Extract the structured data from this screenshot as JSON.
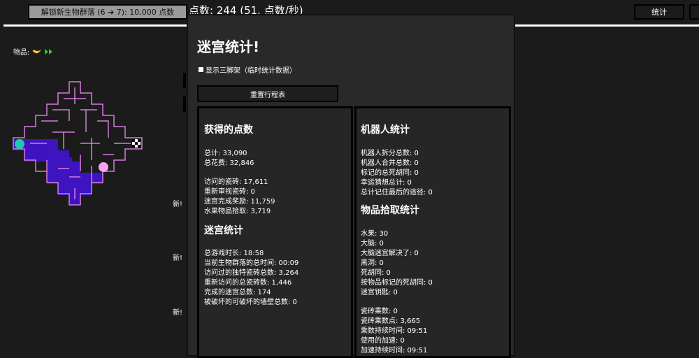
{
  "topbar": {
    "unlock_label": "解锁新生物群落 (6 ➔ 7): 10,000 点数",
    "points_text": "点数: 244 (51. 点数/秒)",
    "stats_label": "统计"
  },
  "items_label": "物品:",
  "new_labels": [
    "新!",
    "新!",
    "新!"
  ],
  "modal": {
    "title": "迷宫统计!",
    "tripod_label": "显示三脚架（临时统计数据）",
    "reset_label": "重置行程表",
    "left": {
      "points_heading": "获得的点数",
      "points_rows": [
        "总计:   33,090",
        "总花费:   32,846",
        "访问的瓷砖:   17,611",
        "重新审视瓷砖:   0",
        "迷宫完成奖励:   11,759",
        "水果物品拾取:   3,719"
      ],
      "maze_heading": "迷宫统计",
      "maze_rows": [
        "总游戏时长:   18:58",
        "当前生物群落的总时间:   00:09",
        "访问过的独特瓷砖总数:   3,264",
        "重新访问的总瓷砖数:   1,446",
        "完成的迷宫总数:   174",
        "被破坏的可破坏的墙壁总数:   0"
      ]
    },
    "right": {
      "robot_heading": "机器人统计",
      "robot_rows": [
        "机器人拆分总数:   0",
        "机器人合并总数:   0",
        "标记的总死胡同:   0",
        "幸运猜想总计:   0",
        "总计记住最后的途径:   0"
      ],
      "item_heading": "物品拾取统计",
      "item_rows": [
        "水果:   30",
        "大脑:   0",
        "大脑迷宫解决了:   0",
        "黑洞:   0",
        "死胡同:   0",
        "按物品标记的死胡同:   0",
        "迷宫钥匙:   0",
        "瓷砖乘数:   0",
        "瓷砖乘数点:   3,665",
        "乘数持续时间:   09:51",
        "使用的加速:   0",
        "加速持续时间:   09:51"
      ]
    }
  },
  "colors": {
    "maze_wall": "#d67be0",
    "maze_fill": "#3d14c0",
    "robot_start": "#21c6b3",
    "robot_end": "#f7a3f0"
  },
  "icons": [
    "banana-icon",
    "speed-icon",
    "checkered-flag-icon"
  ]
}
